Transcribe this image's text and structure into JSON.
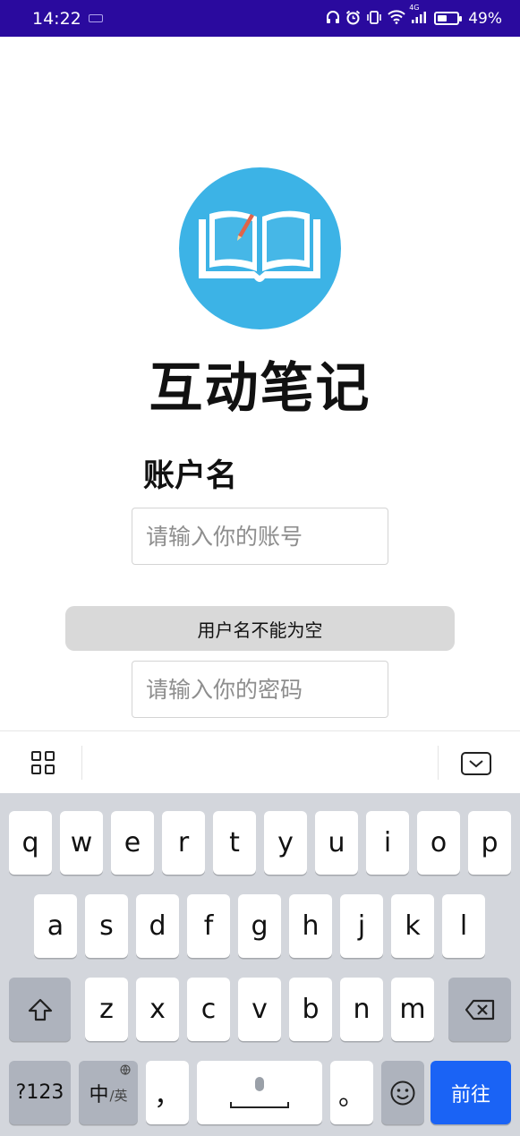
{
  "status_bar": {
    "time": "14:22",
    "battery": "49%",
    "battery_level": 0.49,
    "network": "4G",
    "icons": [
      "headphones-icon",
      "alarm-icon",
      "vibrate-icon",
      "wifi-icon",
      "signal-icon",
      "battery-icon"
    ]
  },
  "app": {
    "logo_icon": "open-book-icon",
    "logo_color": "#3cb3e6",
    "title": "互动笔记"
  },
  "form": {
    "account_label": "账户名",
    "account_placeholder": "请输入你的账号",
    "password_placeholder": "请输入你的密码",
    "toast": "用户名不能为空"
  },
  "keyboard": {
    "toolbar_icons": [
      "grid-icon",
      "collapse-keyboard-icon"
    ],
    "row1": [
      "q",
      "w",
      "e",
      "r",
      "t",
      "y",
      "u",
      "i",
      "o",
      "p"
    ],
    "row2": [
      "a",
      "s",
      "d",
      "f",
      "g",
      "h",
      "j",
      "k",
      "l"
    ],
    "row3": [
      "z",
      "x",
      "c",
      "v",
      "b",
      "n",
      "m"
    ],
    "symbols_label": "?123",
    "lang_main": "中",
    "lang_sub": "/英",
    "comma": "，",
    "period": "。",
    "go_label": "前往",
    "go_color": "#1a63f5"
  }
}
